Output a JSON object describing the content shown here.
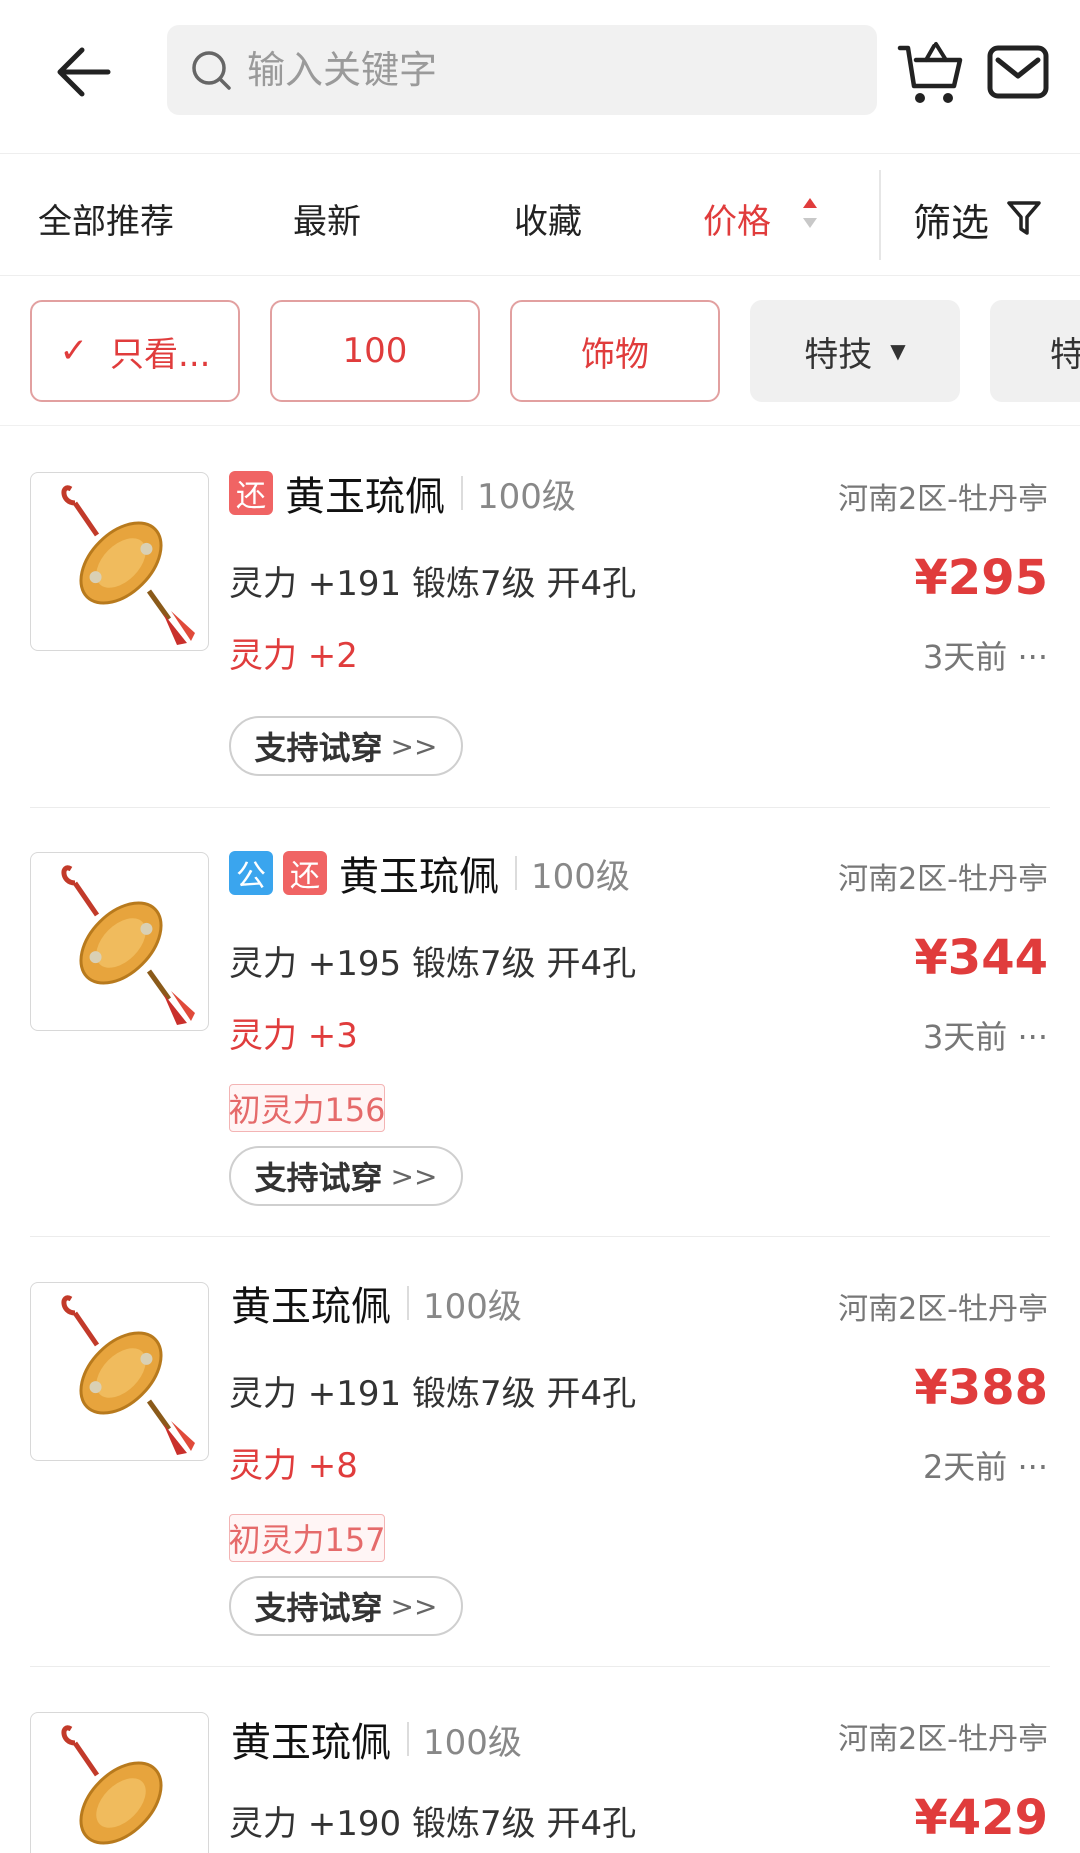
{
  "header": {
    "search_placeholder": "输入关键字"
  },
  "sort_tabs": [
    {
      "label": "全部推荐"
    },
    {
      "label": "最新"
    },
    {
      "label": "收藏"
    },
    {
      "label": "价格",
      "active": true
    }
  ],
  "filter": {
    "label": "筛选"
  },
  "chips": [
    {
      "label": "只看...",
      "checked": true
    },
    {
      "label": "100"
    },
    {
      "label": "饰物"
    },
    {
      "label": "特技"
    },
    {
      "label": "特"
    }
  ],
  "items": [
    {
      "tags": [
        "还"
      ],
      "name": "黄玉琉佩",
      "level": "100级",
      "server": "河南2区-牡丹亭",
      "attr": "灵力 +191 锻炼7级 开4孔",
      "bonus": "灵力 +2",
      "price": "¥295",
      "time": "3天前 ···",
      "try_on": "支持试穿"
    },
    {
      "tags": [
        "公",
        "还"
      ],
      "name": "黄玉琉佩",
      "level": "100级",
      "server": "河南2区-牡丹亭",
      "attr": "灵力 +195 锻炼7级 开4孔",
      "bonus": "灵力 +3",
      "init": "初灵力156",
      "price": "¥344",
      "time": "3天前 ···",
      "try_on": "支持试穿"
    },
    {
      "tags": [],
      "name": "黄玉琉佩",
      "level": "100级",
      "server": "河南2区-牡丹亭",
      "attr": "灵力 +191 锻炼7级 开4孔",
      "bonus": "灵力 +8",
      "init": "初灵力157",
      "price": "¥388",
      "time": "2天前 ···",
      "try_on": "支持试穿"
    },
    {
      "tags": [],
      "name": "黄玉琉佩",
      "level": "100级",
      "server": "河南2区-牡丹亭",
      "attr": "灵力 +190 锻炼7级 开4孔",
      "price": "¥429"
    }
  ],
  "icons": {
    "back": "back-arrow-icon",
    "search": "search-icon",
    "cart": "cart-icon",
    "mail": "mail-icon",
    "sort": "sort-arrows-icon",
    "filter": "filter-funnel-icon",
    "check": "check-icon",
    "caret": "caret-down-icon",
    "thumb": "jade-pendant-image"
  },
  "colors": {
    "accent_red": "#e03c3c",
    "tag_return": "#f06464",
    "tag_public": "#3aa5ee",
    "chip_border": "#e2a0a0"
  }
}
